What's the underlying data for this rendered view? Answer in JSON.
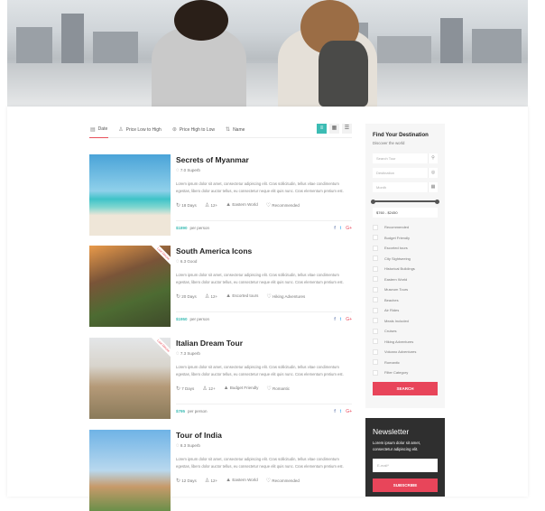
{
  "sort": {
    "items": [
      {
        "label": "Date",
        "icon": "calendar-icon"
      },
      {
        "label": "Price Low to High",
        "icon": "price-icon"
      },
      {
        "label": "Price High to Low",
        "icon": "price-icon"
      },
      {
        "label": "Name",
        "icon": "sort-alpha-icon"
      }
    ],
    "active": "Date"
  },
  "tours": [
    {
      "title": "Secrets of Myanmar",
      "rating": "7.0 Superb",
      "desc": "Lorem ipsum dolor sit amet, consectetur adipiscing elit. Cras sollicitudin, tellus vitae condimentum egestas, libero dolor auctor tellus, eu consectetur neque elit quis nunc. Cras elementum pretium est.",
      "days": "18 Days",
      "age": "12+",
      "tag1": "Eastern World",
      "tag2": "Recommended",
      "price": "$1890",
      "per": "per person",
      "ribbon": ""
    },
    {
      "title": "South America Icons",
      "rating": "6.3 Good",
      "desc": "Lorem ipsum dolor sit amet, consectetur adipiscing elit. Cras sollicitudin, tellus vitae condimentum egestas, libero dolor auctor tellus, eu consectetur neque elit quis nunc. Cras elementum pretium est.",
      "days": "20 Days",
      "age": "12+",
      "tag1": "Escorted tours",
      "tag2": "Hiking Adventures",
      "price": "$1950",
      "per": "per person",
      "ribbon": "Last Minute"
    },
    {
      "title": "Italian Dream Tour",
      "rating": "7.3 Superb",
      "desc": "Lorem ipsum dolor sit amet, consectetur adipiscing elit. Cras sollicitudin, tellus vitae condimentum egestas, libero dolor auctor tellus, eu consectetur neque elit quis nunc. Cras elementum pretium est.",
      "days": "7 Days",
      "age": "12+",
      "tag1": "Budget Friendly",
      "tag2": "Romantic",
      "price": "$795",
      "per": "per person",
      "ribbon": "Last Minute"
    },
    {
      "title": "Tour of India",
      "rating": "8.3 Superb",
      "desc": "Lorem ipsum dolor sit amet, consectetur adipiscing elit. Cras sollicitudin, tellus vitae condimentum egestas, libero dolor auctor tellus, eu consectetur neque elit quis nunc. Cras elementum pretium est.",
      "days": "12 Days",
      "age": "12+",
      "tag1": "Eastern World",
      "tag2": "Recommended",
      "price": "",
      "per": "",
      "ribbon": ""
    }
  ],
  "sidebar": {
    "title": "Find Your Destination",
    "subtitle": "Discover the world",
    "search_placeholder": "Search Tour",
    "destination_placeholder": "Destination",
    "month_placeholder": "Month",
    "price_range": "$760 - $2450",
    "price_slider": {
      "min": 760,
      "max": 2450
    },
    "categories": [
      "Recommended",
      "Budget Friendly",
      "Escorted tours",
      "City Sightseeing",
      "Historical Buildings",
      "Eastern World",
      "Museum Tours",
      "Beaches",
      "Air Rides",
      "Meals Included",
      "Cruises",
      "Hiking Adventures",
      "Volcano Adventures",
      "Romantic",
      "Filter Category"
    ],
    "search_button": "SEARCH"
  },
  "newsletter": {
    "title": "Newsletter",
    "text": "Lorem ipsum dolor sit amet, consectetur adipiscing elit.",
    "email_placeholder": "E-mail*",
    "button": "SUBSCRIBE"
  },
  "colors": {
    "accent": "#3cbcb4",
    "red": "#e8455a"
  }
}
